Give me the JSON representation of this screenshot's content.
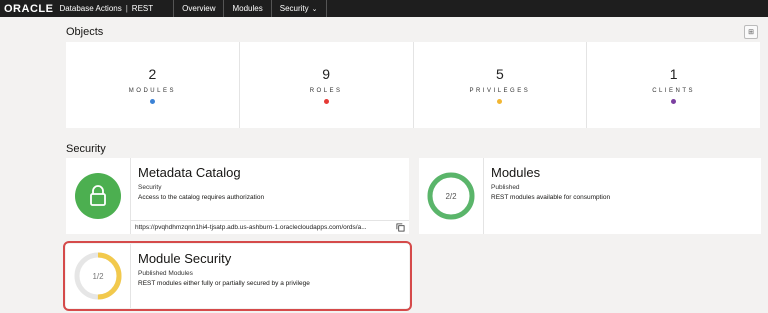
{
  "header": {
    "logo": "ORACLE",
    "product": "Database Actions",
    "separator": "|",
    "section": "REST",
    "nav": [
      {
        "label": "Overview"
      },
      {
        "label": "Modules"
      },
      {
        "label": "Security"
      }
    ]
  },
  "objects": {
    "title": "Objects",
    "stats": [
      {
        "value": "2",
        "label": "MODULES",
        "color": "#3b82d6"
      },
      {
        "value": "9",
        "label": "ROLES",
        "color": "#e53935"
      },
      {
        "value": "5",
        "label": "PRIVILEGES",
        "color": "#f2b632"
      },
      {
        "value": "1",
        "label": "CLIENTS",
        "color": "#7b3fa0"
      }
    ]
  },
  "security": {
    "title": "Security",
    "metadata_catalog": {
      "title": "Metadata Catalog",
      "subtitle": "Security",
      "description": "Access to the catalog requires authorization",
      "url": "https://pvqhdhmzqnn1hi4-tjsatp.adb.us-ashburn-1.oraclecloudapps.com/ords/a..."
    },
    "modules": {
      "title": "Modules",
      "subtitle": "Published",
      "description": "REST modules available for consumption",
      "gauge_text": "2/2",
      "ratio": 1.0,
      "color": "#5ab56a"
    },
    "module_security": {
      "title": "Module Security",
      "subtitle": "Published Modules",
      "description": "REST modules either fully or partially secured by a privilege",
      "gauge_text": "1/2",
      "ratio": 0.5,
      "color": "#f2c94c"
    }
  }
}
